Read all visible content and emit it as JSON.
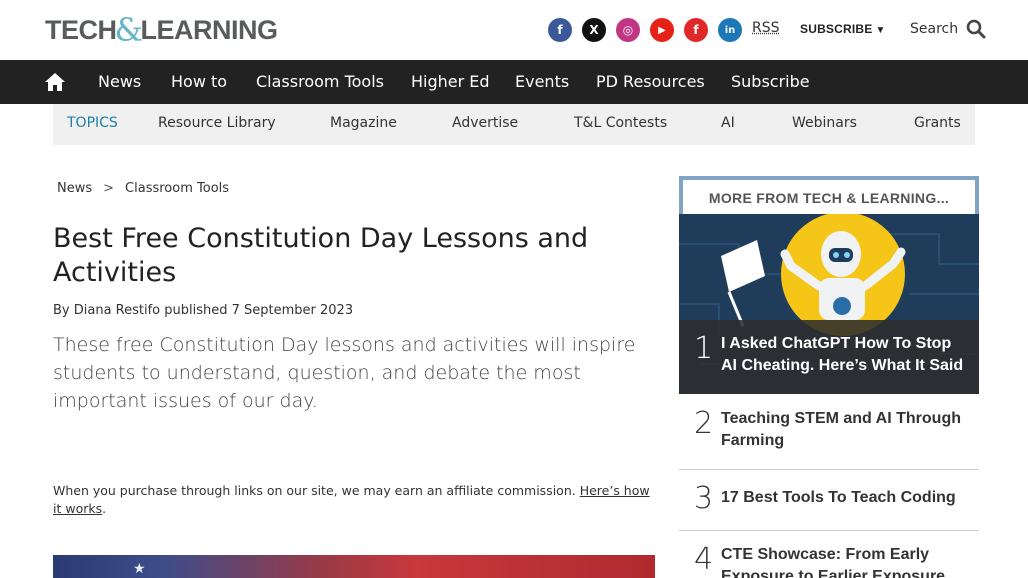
{
  "header": {
    "logo_left": "TECH",
    "logo_amp": "&",
    "logo_right": "LEARNING",
    "social": [
      {
        "name": "facebook-icon",
        "glyph": "f",
        "color": "#3b5998"
      },
      {
        "name": "x-twitter-icon",
        "glyph": "X",
        "color": "#111111"
      },
      {
        "name": "instagram-icon",
        "glyph": "◎",
        "color": "#c13584"
      },
      {
        "name": "youtube-icon",
        "glyph": "▶",
        "color": "#e62117"
      },
      {
        "name": "flipboard-icon",
        "glyph": "f",
        "color": "#e12828"
      },
      {
        "name": "linkedin-icon",
        "glyph": "in",
        "color": "#1b77b8"
      }
    ],
    "rss": "RSS",
    "subscribe": "SUBSCRIBE",
    "search": "Search"
  },
  "nav": {
    "items": [
      "News",
      "How to",
      "Classroom Tools",
      "Higher Ed",
      "Events",
      "PD Resources",
      "Subscribe"
    ]
  },
  "topics": {
    "items": [
      "TOPICS",
      "Resource Library",
      "Magazine",
      "Advertise",
      "T&L Contests",
      "AI",
      "Webinars",
      "Grants"
    ]
  },
  "article": {
    "breadcrumb": [
      "News",
      ">",
      "Classroom Tools"
    ],
    "title": "Best Free Constitution Day Lessons and Activities",
    "byline": "By Diana Restifo published 7 September 2023",
    "lede": "These free Constitution Day lessons and activities will inspire students to understand, question, and debate the most important issues of our day.",
    "affiliate_text": "When you purchase through links on our site, we may earn an affiliate commission.",
    "affiliate_link": "Here’s how it works",
    "affiliate_end": "."
  },
  "sidebar": {
    "heading": "MORE FROM TECH & LEARNING...",
    "items": [
      {
        "rank": "1",
        "title": "I Asked ChatGPT How To Stop AI Cheating. Here’s What It Said"
      },
      {
        "rank": "2",
        "title": "Teaching STEM and AI Through Farming"
      },
      {
        "rank": "3",
        "title": "17 Best Tools To Teach Coding"
      },
      {
        "rank": "4",
        "title": "CTE Showcase: From Early Exposure to Earlier Exposure"
      }
    ]
  }
}
